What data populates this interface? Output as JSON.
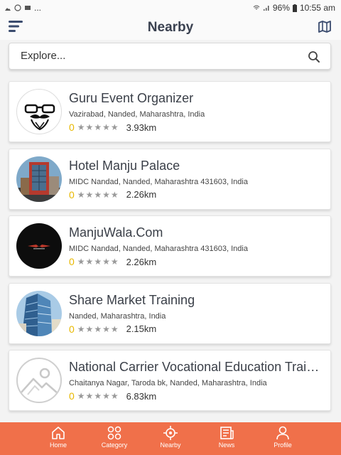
{
  "status_bar": {
    "left_dots": "...",
    "battery": "96%",
    "time": "10:55 am"
  },
  "header": {
    "title": "Nearby",
    "menu_icon": "menu-icon",
    "map_icon": "map-icon"
  },
  "search": {
    "placeholder": "Explore...",
    "icon": "search-icon"
  },
  "listings": [
    {
      "name": "Guru Event Organizer",
      "address": "Vazirabad, Nanded, Maharashtra, India",
      "rating": "0",
      "stars": "★★★★★",
      "distance": "3.93km",
      "avatar": "mustache-logo"
    },
    {
      "name": "Hotel Manju Palace",
      "address": "MIDC Nandad, Nanded, Maharashtra 431603, India",
      "rating": "0",
      "stars": "★★★★★",
      "distance": "2.26km",
      "avatar": "hotel-photo"
    },
    {
      "name": "ManjuWala.Com",
      "address": "MIDC Nandad, Nanded, Maharashtra 431603, India",
      "rating": "0",
      "stars": "★★★★★",
      "distance": "2.26km",
      "avatar": "dark-logo"
    },
    {
      "name": "Share Market Training",
      "address": "Nanded, Maharashtra, India",
      "rating": "0",
      "stars": "★★★★★",
      "distance": "2.15km",
      "avatar": "building-photo"
    },
    {
      "name": "National Carrier Vocational Education Trainin...",
      "address": "Chaitanya Nagar, Taroda bk, Nanded, Maharashtra, India",
      "rating": "0",
      "stars": "★★★★★",
      "distance": "6.83km",
      "avatar": "image-placeholder"
    }
  ],
  "bottom_nav": [
    {
      "label": "Home",
      "icon": "home-icon"
    },
    {
      "label": "Category",
      "icon": "category-icon"
    },
    {
      "label": "Nearby",
      "icon": "nearby-icon"
    },
    {
      "label": "News",
      "icon": "news-icon"
    },
    {
      "label": "Profile",
      "icon": "profile-icon"
    }
  ],
  "colors": {
    "accent": "#f0704a",
    "rating": "#e8b800",
    "title": "#3a4150"
  }
}
